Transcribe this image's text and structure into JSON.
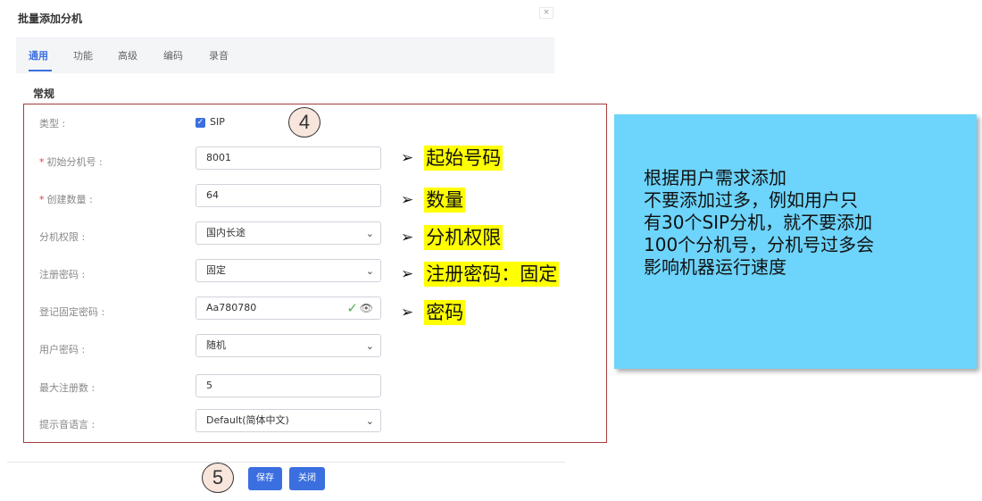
{
  "dialog": {
    "title": "批量添加分机",
    "close": "×"
  },
  "tabs": [
    {
      "label": "通用",
      "active": true
    },
    {
      "label": "功能"
    },
    {
      "label": "高级"
    },
    {
      "label": "编码"
    },
    {
      "label": "录音"
    }
  ],
  "section_title": "常规",
  "form": {
    "type": {
      "label": "类型 :",
      "option": "SIP",
      "checked": true
    },
    "start_ext": {
      "label": "初始分机号 :",
      "required": "*",
      "value": "8001"
    },
    "count": {
      "label": "创建数量 :",
      "required": "*",
      "value": "64"
    },
    "permission": {
      "label": "分机权限 :",
      "value": "国内长途"
    },
    "reg_password": {
      "label": "注册密码 :",
      "value": "固定"
    },
    "fixed_password": {
      "label": "登记固定密码 :",
      "value": "Aa780780"
    },
    "user_password": {
      "label": "用户密码 :",
      "value": "随机"
    },
    "max_reg": {
      "label": "最大注册数 :",
      "value": "5"
    },
    "prompt_lang": {
      "label": "提示音语言 :",
      "value": "Default(简体中文)"
    }
  },
  "markers": {
    "form": "4",
    "buttons": "5"
  },
  "callouts": [
    {
      "arrow": "➢",
      "text": "起始号码"
    },
    {
      "arrow": "➢",
      "text": "数量"
    },
    {
      "arrow": "➢",
      "text": "分机权限"
    },
    {
      "arrow": "➢",
      "text": "注册密码：固定"
    },
    {
      "arrow": "➢",
      "text": "密码"
    }
  ],
  "buttons": {
    "save": "保存",
    "close": "关闭"
  },
  "note_lines": [
    "根据用户需求添加",
    "不要添加过多，例如用户只",
    "有30个SIP分机，就不要添加",
    "100个分机号，分机号过多会",
    "影响机器运行速度"
  ],
  "colors": {
    "accent": "#3b6fe0",
    "highlight": "#ffff00",
    "note_bg": "#6dd4fb",
    "frame": "#a53c3c"
  }
}
